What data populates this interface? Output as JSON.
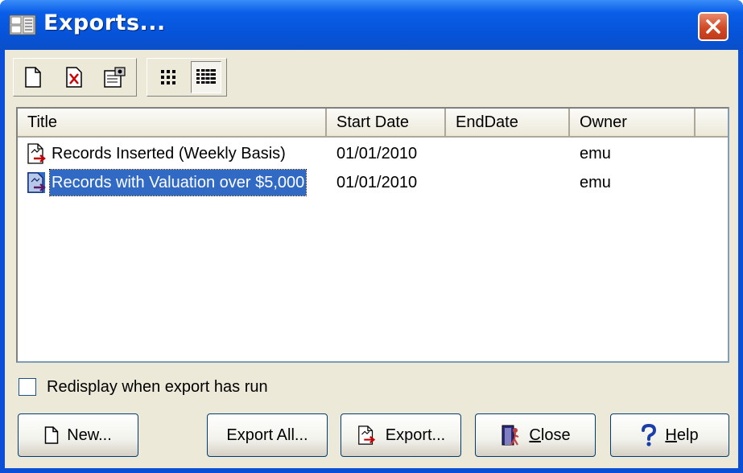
{
  "window": {
    "title": "Exports..."
  },
  "toolbar": {
    "buttons": [
      {
        "icon": "new-document-icon"
      },
      {
        "icon": "delete-document-icon"
      },
      {
        "icon": "properties-icon"
      },
      {
        "icon": "large-icons-view-icon"
      },
      {
        "icon": "details-view-icon",
        "pressed": true
      }
    ]
  },
  "list": {
    "columns": [
      "Title",
      "Start Date",
      "EndDate",
      "Owner"
    ],
    "rows": [
      {
        "title": "Records Inserted (Weekly Basis)",
        "start_date": "01/01/2010",
        "end_date": "",
        "owner": "emu",
        "selected": false
      },
      {
        "title": "Records with Valuation over $5,000",
        "start_date": "01/01/2010",
        "end_date": "",
        "owner": "emu",
        "selected": true
      }
    ]
  },
  "options": {
    "redisplay_label": "Redisplay when export has run",
    "redisplay_checked": false
  },
  "buttons": {
    "new": "New...",
    "export_all": "Export All...",
    "export": "Export...",
    "close_mnemonic": "C",
    "close_rest": "lose",
    "help_mnemonic": "H",
    "help_rest": "elp"
  },
  "colors": {
    "titlebar": "#0653d8",
    "selection": "#316ac5",
    "face": "#ece9d8"
  }
}
